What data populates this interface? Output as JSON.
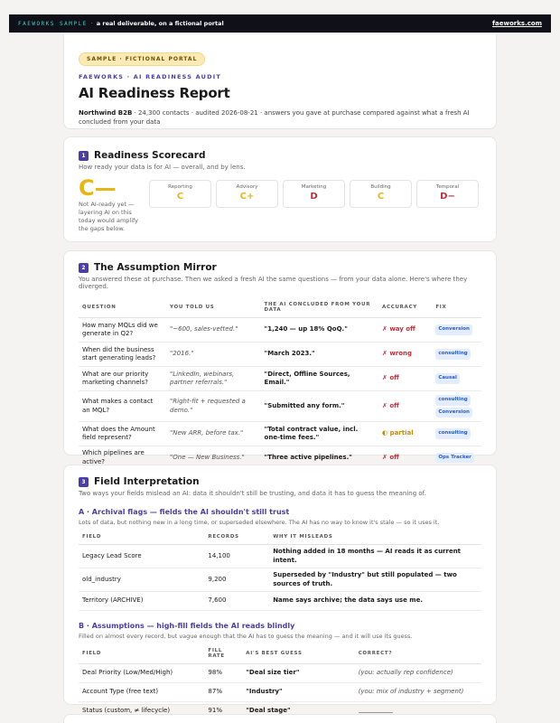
{
  "topbar": {
    "brand": "FAEWORKS SAMPLE",
    "tagline": "a real deliverable, on a fictional portal",
    "site": "faeworks.com"
  },
  "header": {
    "pill": "SAMPLE · FICTIONAL PORTAL",
    "eyebrow": "FAEWORKS · AI READINESS AUDIT",
    "title": "AI Readiness Report",
    "company": "Northwind B2B",
    "meta": " · 24,300 contacts · audited 2026-08-21 · answers you gave at purchase compared against what a fresh AI concluded from your data"
  },
  "scorecard": {
    "num": "1",
    "title": "Readiness Scorecard",
    "sub": "How ready your data is for AI — overall, and by lens.",
    "overall_grade": "C—",
    "overall_note": "Not AI-ready yet — layering AI on this today would amplify the gaps below.",
    "lenses": [
      {
        "label": "Reporting",
        "grade": "C",
        "color": "#e7b51a"
      },
      {
        "label": "Advisory",
        "grade": "C+",
        "color": "#e7b51a"
      },
      {
        "label": "Marketing",
        "grade": "D",
        "color": "#c0303a"
      },
      {
        "label": "Building",
        "grade": "C",
        "color": "#e7b51a"
      },
      {
        "label": "Temporal",
        "grade": "D−",
        "color": "#c0303a"
      }
    ]
  },
  "mirror": {
    "num": "2",
    "title": "The Assumption Mirror",
    "sub": "You answered these at purchase. Then we asked a fresh AI the same questions — from your data alone. Here's where they diverged.",
    "headers": [
      "QUESTION",
      "YOU TOLD US",
      "THE AI CONCLUDED FROM YOUR DATA",
      "ACCURACY",
      "FIX"
    ],
    "rows": [
      {
        "q": "How many MQLs did we generate in Q2?",
        "told": "\"~600, sales-vetted.\"",
        "ai": "\"1,240 — up 18% QoQ.\"",
        "acc": "✗ way off",
        "acc_type": "bad",
        "fix": [
          "Conversion"
        ]
      },
      {
        "q": "When did the business start generating leads?",
        "told": "\"2016.\"",
        "ai": "\"March 2023.\"",
        "acc": "✗ wrong",
        "acc_type": "bad",
        "fix": [
          "consulting"
        ]
      },
      {
        "q": "What are our priority marketing channels?",
        "told": "\"LinkedIn, webinars, partner referrals.\"",
        "ai": "\"Direct, Offline Sources, Email.\"",
        "acc": "✗ off",
        "acc_type": "bad",
        "fix": [
          "Causal"
        ]
      },
      {
        "q": "What makes a contact an MQL?",
        "told": "\"Right-fit + requested a demo.\"",
        "ai": "\"Submitted any form.\"",
        "acc": "✗ off",
        "acc_type": "bad",
        "fix": [
          "consulting",
          "Conversion"
        ]
      },
      {
        "q": "What does the Amount field represent?",
        "told": "\"New ARR, before tax.\"",
        "ai": "\"Total contract value, incl. one-time fees.\"",
        "acc": "◐ partial",
        "acc_type": "partial",
        "fix": [
          "consulting"
        ]
      },
      {
        "q": "Which pipelines are active?",
        "told": "\"One — New Business.\"",
        "ai": "\"Three active pipelines.\"",
        "acc": "✗ off",
        "acc_type": "bad",
        "fix": [
          "Ops Tracker"
        ]
      }
    ]
  },
  "fields": {
    "num": "3",
    "title": "Field Interpretation",
    "sub": "Two ways your fields mislead an AI: data it shouldn't still be trusting, and data it has to guess the meaning of.",
    "archival": {
      "title": "A · Archival flags — fields the AI shouldn't still trust",
      "note": "Lots of data, but nothing new in a long time, or superseded elsewhere. The AI has no way to know it's stale — so it uses it.",
      "headers": [
        "FIELD",
        "RECORDS",
        "WHY IT MISLEADS"
      ],
      "rows": [
        {
          "field": "Legacy Lead Score",
          "records": "14,100",
          "why": "Nothing added in 18 months — AI reads it as current intent."
        },
        {
          "field": "old_industry",
          "records": "9,200",
          "why": "Superseded by \"Industry\" but still populated — two sources of truth."
        },
        {
          "field": "Territory (ARCHIVE)",
          "records": "7,600",
          "why": "Name says archive; the data says use me."
        }
      ]
    },
    "assumptions": {
      "title": "B · Assumptions — high-fill fields the AI reads blindly",
      "note": "Filled on almost every record, but vague enough that the AI has to guess the meaning — and it will use its guess.",
      "headers": [
        "FIELD",
        "FILL RATE",
        "AI'S BEST GUESS",
        "CORRECT?"
      ],
      "rows": [
        {
          "field": "Deal Priority (Low/Med/High)",
          "fill": "98%",
          "guess": "\"Deal size tier\"",
          "correct": "(you: actually rep confidence)"
        },
        {
          "field": "Account Type (free text)",
          "fill": "87%",
          "guess": "\"Industry\"",
          "correct": "(you: mix of industry + segment)"
        },
        {
          "field": "Status (custom, ≠ lifecycle)",
          "fill": "91%",
          "guess": "\"Deal stage\"",
          "correct": ""
        }
      ]
    }
  }
}
